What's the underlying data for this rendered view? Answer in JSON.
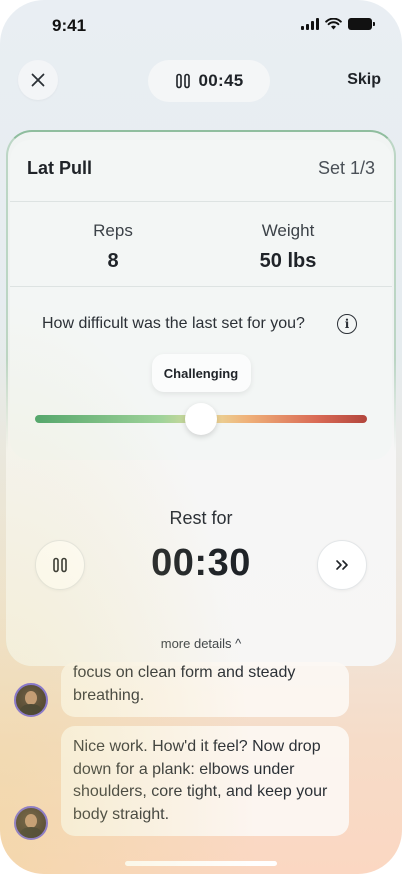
{
  "status_bar": {
    "time": "9:41"
  },
  "header": {
    "close_icon": "close-icon",
    "timer": "00:45",
    "pause_icon": "pause-icon",
    "skip_label": "Skip"
  },
  "exercise": {
    "name": "Lat Pull",
    "set_label": "Set 1/3",
    "stats": [
      {
        "label": "Reps",
        "value": "8"
      },
      {
        "label": "Weight",
        "value": "50 lbs"
      }
    ],
    "difficulty_question": "How difficult was the last set for you?",
    "difficulty_value": "Challenging",
    "difficulty_level": 0.5
  },
  "rest": {
    "label": "Rest for",
    "time": "00:30",
    "pause_icon": "pause-icon",
    "skip_icon": "fast-forward-icon"
  },
  "more_details_label": "more details ^",
  "chat": [
    {
      "text": "focus on clean form and steady breathing."
    },
    {
      "text": "Nice work. How'd it feel? Now drop down for a plank: elbows under shoulders, core tight, and keep your body straight."
    }
  ],
  "colors": {
    "card_border": "#8fbd9e",
    "slider_start": "#4aa36a",
    "slider_end": "#b2463d",
    "avatar_ring": "#6a5ae0"
  }
}
